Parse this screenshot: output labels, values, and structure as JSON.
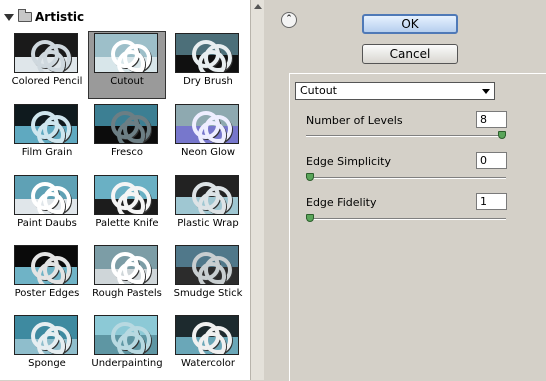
{
  "gallery": {
    "category": "Artistic",
    "filters": [
      {
        "label": "Colored Pencil",
        "selected": false
      },
      {
        "label": "Cutout",
        "selected": true
      },
      {
        "label": "Dry Brush",
        "selected": false
      },
      {
        "label": "Film Grain",
        "selected": false
      },
      {
        "label": "Fresco",
        "selected": false
      },
      {
        "label": "Neon Glow",
        "selected": false
      },
      {
        "label": "Paint Daubs",
        "selected": false
      },
      {
        "label": "Palette Knife",
        "selected": false
      },
      {
        "label": "Plastic Wrap",
        "selected": false
      },
      {
        "label": "Poster Edges",
        "selected": false
      },
      {
        "label": "Rough Pastels",
        "selected": false
      },
      {
        "label": "Smudge Stick",
        "selected": false
      },
      {
        "label": "Sponge",
        "selected": false
      },
      {
        "label": "Underpainting",
        "selected": false
      },
      {
        "label": "Watercolor",
        "selected": false
      }
    ]
  },
  "buttons": {
    "ok": "OK",
    "cancel": "Cancel"
  },
  "filter_select": {
    "value": "Cutout"
  },
  "params": [
    {
      "label": "Number of Levels",
      "value": "8",
      "slider_fraction": 1.0
    },
    {
      "label": "Edge Simplicity",
      "value": "0",
      "slider_fraction": 0.0
    },
    {
      "label": "Edge Fidelity",
      "value": "1",
      "slider_fraction": 0.0
    }
  ],
  "colors": {
    "selected_cell": "#9a9a9a",
    "ok_border": "#4f79b7",
    "slider_knob": "#5aa55a"
  }
}
